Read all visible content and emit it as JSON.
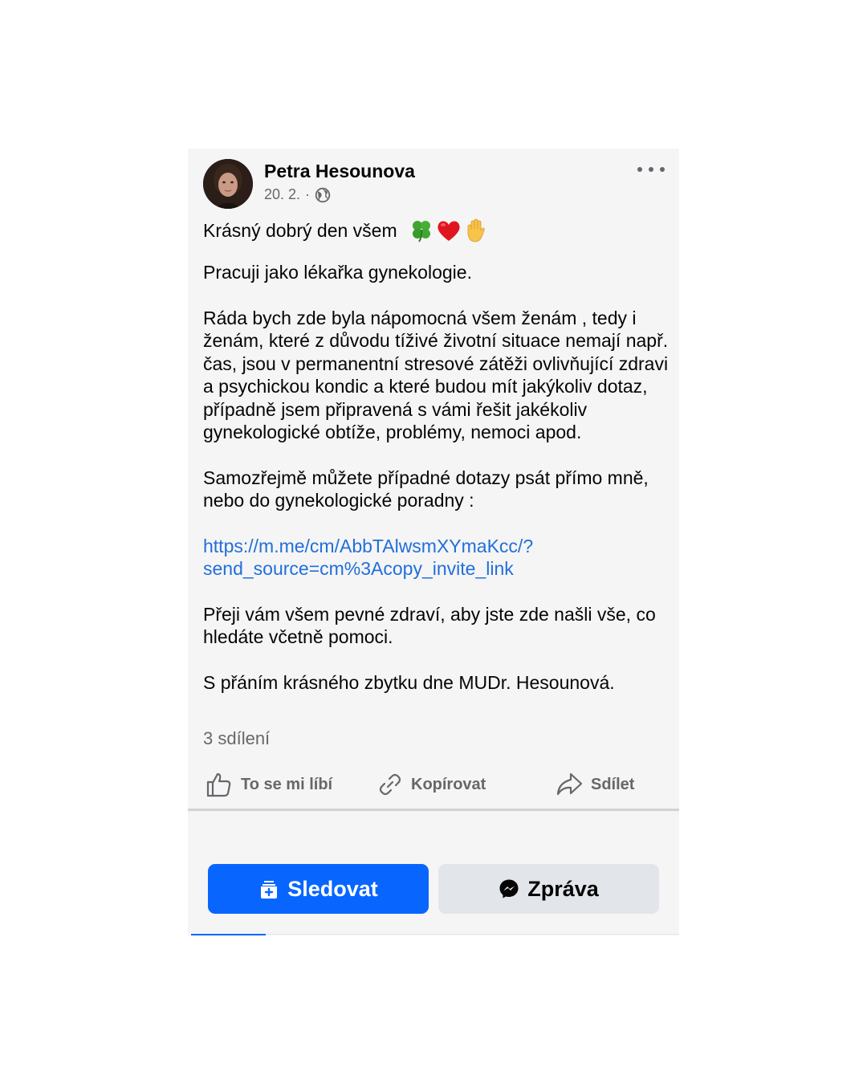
{
  "post": {
    "author": "Petra Hesounova",
    "date": "20. 2.",
    "separator": "·",
    "greeting": "Krásný dobrý den všem",
    "greeting_emoji": [
      "four-leaf-clover",
      "red-heart",
      "raised-hand"
    ],
    "paragraph_1": "Pracuji jako lékařka gynekologie.",
    "paragraph_2": "Ráda bych zde byla nápomocná všem ženám , tedy i ženám, které z důvodu tíživé životní situace nemají např. čas, jsou v permanentní stresové zátěži ovlivňující zdravi a psychickou kondic a které budou mít  jakýkoliv dotaz, případně jsem připravená s vámi řešit jakékoliv gynekologické obtíže, problémy, nemoci apod.",
    "paragraph_3": "Samozřejmě můžete případné dotazy psát přímo mně, nebo do gynekologické poradny :",
    "link_line_1": "https://m.me/cm/AbbTAlwsmXYmaKcc/?",
    "link_line_2": "send_source=cm%3Acopy_invite_link",
    "paragraph_4": "Přeji vám všem pevné zdraví, aby jste zde našli vše, co hledáte včetně pomoci.",
    "paragraph_5": "S přáním krásného zbytku dne MUDr. Hesounová.",
    "shares": "3 sdílení"
  },
  "actions": {
    "like": "To se mi líbí",
    "copy": "Kopírovat",
    "share": "Sdílet"
  },
  "buttons": {
    "follow": "Sledovat",
    "message": "Zpráva"
  },
  "colors": {
    "accent": "#0866ff",
    "link": "#216fdb",
    "secondary_text": "#65676b",
    "card_bg": "#f5f5f5"
  },
  "icons": [
    "more-icon",
    "globe-icon",
    "like-icon",
    "link-icon",
    "share-icon",
    "follow-icon",
    "messenger-icon"
  ]
}
